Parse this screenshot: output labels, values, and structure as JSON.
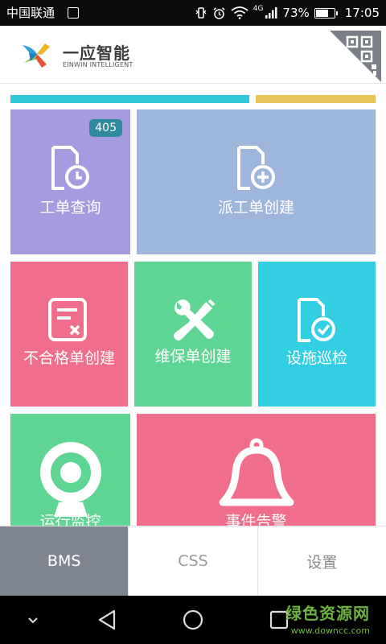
{
  "status_bar": {
    "carrier": "中国联通",
    "network_type": "4G",
    "battery_text": "73%",
    "battery_level": 0.73,
    "time": "17:05"
  },
  "header": {
    "brand_name": "一应智能",
    "brand_sub": "EINWIN INTELLIGENT"
  },
  "colors": {
    "stripe_cyan": "#32c8dc",
    "stripe_yellow": "#e8c25a",
    "tile_purple": "#a59be0",
    "tile_blue": "#9fb6dc",
    "tile_pink": "#f06e8c",
    "tile_green": "#5fd594",
    "tile_cyan": "#32cfe3",
    "nav_active": "#7f8590"
  },
  "tiles": {
    "work_order_query": {
      "label": "工单查询",
      "badge": "405",
      "icon": "document-clock-icon"
    },
    "dispatch_order_create": {
      "label": "派工单创建",
      "icon": "document-plus-icon"
    },
    "nonconformity_create": {
      "label": "不合格单创建",
      "icon": "document-x-icon"
    },
    "maintenance_create": {
      "label": "维保单创建",
      "icon": "wrench-screwdriver-icon"
    },
    "facility_inspection": {
      "label": "设施巡检",
      "icon": "document-check-icon"
    },
    "operation_monitor": {
      "label": "运行监控",
      "icon": "webcam-icon"
    },
    "event_alarm": {
      "label": "事件告警",
      "icon": "bell-icon"
    }
  },
  "bottom_nav": {
    "tabs": [
      "BMS",
      "CSS",
      "设置"
    ],
    "active": "BMS"
  },
  "watermark": {
    "main": "绿色资源网",
    "url": "www.downcc.com"
  }
}
